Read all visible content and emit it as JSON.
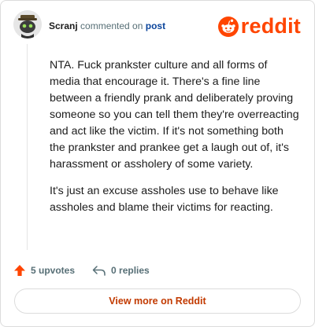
{
  "comment": {
    "username": "Scranj",
    "action_text": " commented on ",
    "post_link": "post",
    "paragraphs": [
      "NTA. Fuck prankster culture and all forms of media that encourage it. There's a fine line between a friendly prank and deliberately proving someone so you can tell them they're overreacting and act like the victim. If it's not something both the prankster and prankee get a laugh out of, it's harassment or assholery of some variety.",
      "It's just an excuse assholes use to behave like assholes and blame their victims for reacting."
    ]
  },
  "brand": {
    "name": "reddit",
    "color": "#ff4500"
  },
  "footer": {
    "upvotes_label": "5 upvotes",
    "replies_label": "0 replies"
  },
  "view_more_label": "View more on Reddit",
  "icons": {
    "avatar": "user-avatar",
    "logo": "reddit-snoo-icon",
    "upvote": "upvote-arrow-icon",
    "reply": "reply-arrow-icon"
  }
}
